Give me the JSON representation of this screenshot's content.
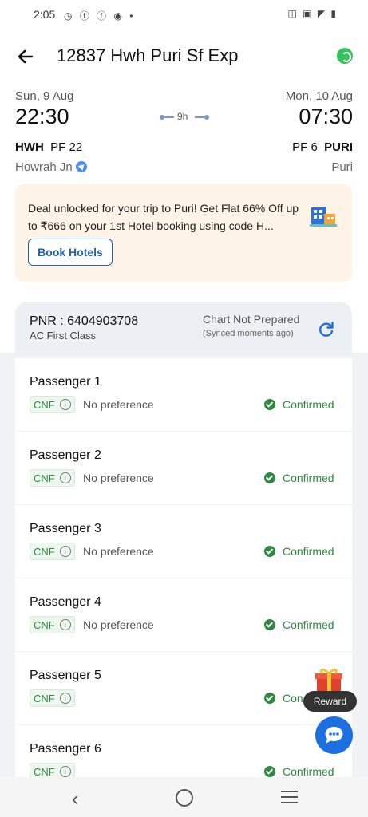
{
  "status_bar": {
    "time": "2:05",
    "left_icons": "◷ ⓕ ⓕ ◉ •",
    "right_icons": "◫ ▣ ◤ ▮"
  },
  "header": {
    "title": "12837 Hwh Puri Sf Exp"
  },
  "journey": {
    "dep_date": "Sun, 9 Aug",
    "dep_time": "22:30",
    "arr_date": "Mon, 10 Aug",
    "arr_time": "07:30",
    "duration": "9h",
    "from_code": "HWH",
    "from_pf": "PF 22",
    "from_city": "Howrah Jn",
    "to_pf": "PF 6",
    "to_code": "PURI",
    "to_city": "Puri"
  },
  "deal": {
    "text": "Deal unlocked for your trip to Puri! Get Flat 66% Off up to ₹666 on your 1st Hotel booking using code H...",
    "button": "Book Hotels"
  },
  "pnr": {
    "label": "PNR : 6404903708",
    "class": "AC First Class",
    "chart_status": "Chart Not Prepared",
    "synced": "(Synced moments ago)"
  },
  "passengers": [
    {
      "name": "Passenger 1",
      "badge": "CNF",
      "pref": "No preference",
      "status": "Confirmed"
    },
    {
      "name": "Passenger 2",
      "badge": "CNF",
      "pref": "No preference",
      "status": "Confirmed"
    },
    {
      "name": "Passenger 3",
      "badge": "CNF",
      "pref": "No preference",
      "status": "Confirmed"
    },
    {
      "name": "Passenger 4",
      "badge": "CNF",
      "pref": "No preference",
      "status": "Confirmed"
    },
    {
      "name": "Passenger 5",
      "badge": "CNF",
      "pref": "",
      "status": "Con"
    },
    {
      "name": "Passenger 6",
      "badge": "CNF",
      "pref": "",
      "status": "Confirmed"
    }
  ],
  "reward": {
    "label": "Reward"
  },
  "icons": {
    "info": "i"
  }
}
